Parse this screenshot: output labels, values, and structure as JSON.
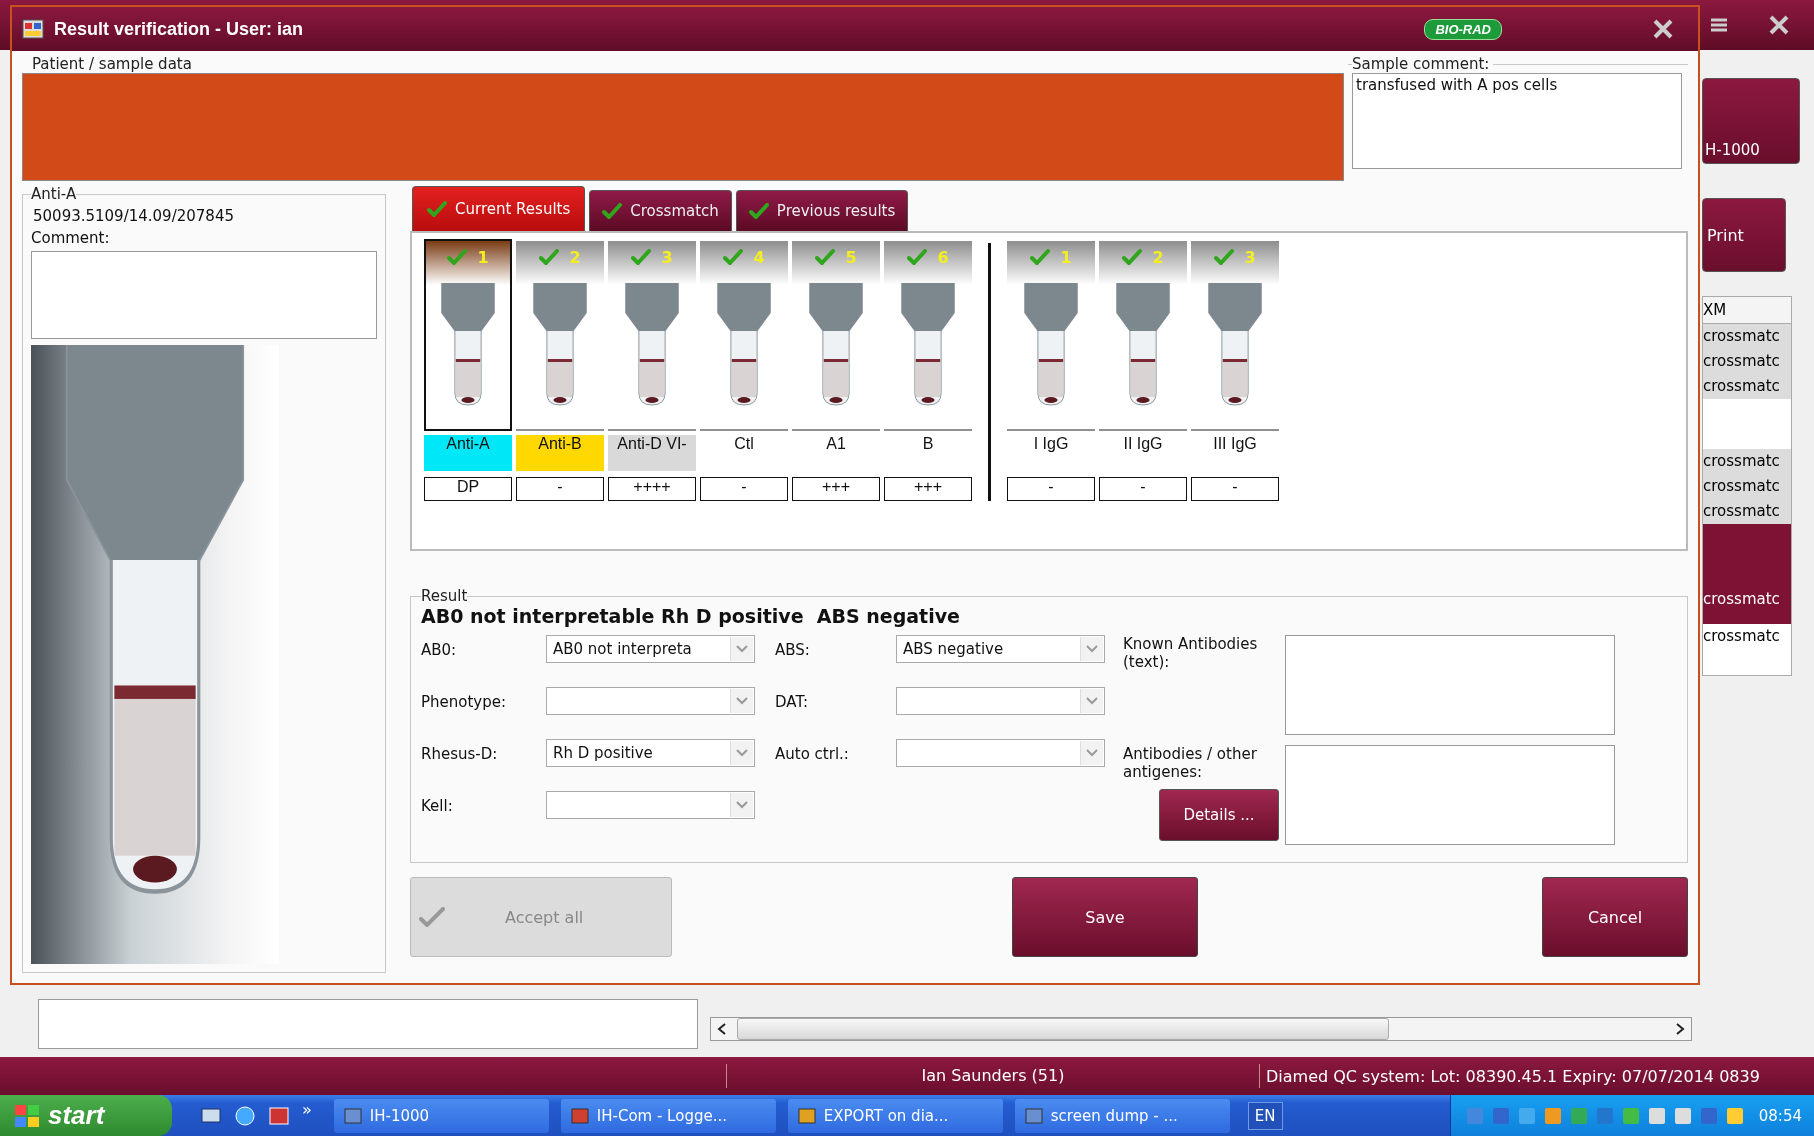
{
  "window": {
    "title": "Result verification - User: ian",
    "logo": "BIO-RAD"
  },
  "patient": {
    "legend": "Patient / sample data"
  },
  "sample_comment": {
    "label": "Sample comment:",
    "value": "transfused with A pos cells"
  },
  "selected_tube": {
    "legend": "Anti-A",
    "code": "50093.5109/14.09/207845",
    "comment_label": "Comment:"
  },
  "tabs": [
    {
      "label": "Current Results",
      "selected": true
    },
    {
      "label": "Crossmatch",
      "selected": false
    },
    {
      "label": "Previous results",
      "selected": false
    }
  ],
  "tube_groups": [
    {
      "tubes": [
        {
          "number": "1",
          "label": "Anti-A",
          "color": "#00e8f8",
          "result": "DP",
          "selected": true
        },
        {
          "number": "2",
          "label": "Anti-B",
          "color": "#ffd800",
          "result": "-",
          "selected": false
        },
        {
          "number": "3",
          "label": "Anti-D VI-",
          "color": "#d9d9d9",
          "result": "++++",
          "selected": false
        },
        {
          "number": "4",
          "label": "Ctl",
          "result": "-",
          "selected": false
        },
        {
          "number": "5",
          "label": "A1",
          "result": "+++",
          "selected": false
        },
        {
          "number": "6",
          "label": "B",
          "result": "+++",
          "selected": false
        }
      ]
    },
    {
      "tubes": [
        {
          "number": "1",
          "label": "I IgG",
          "result": "-",
          "selected": false
        },
        {
          "number": "2",
          "label": "II IgG",
          "result": "-",
          "selected": false
        },
        {
          "number": "3",
          "label": "III IgG",
          "result": "-",
          "selected": false
        }
      ]
    }
  ],
  "result": {
    "legend": "Result",
    "summary": "AB0 not interpretable Rh D positive  ABS negative",
    "fields": [
      {
        "label": "AB0:",
        "value": "AB0 not interpreta"
      },
      {
        "label": "ABS:",
        "value": "ABS negative"
      },
      {
        "label": "Phenotype:"
      },
      {
        "label": "DAT:"
      },
      {
        "label": "Rhesus-D:",
        "value": "Rh D positive"
      },
      {
        "label": "Auto ctrl.:"
      },
      {
        "label": "Kell:"
      }
    ],
    "known_antibodies_label": "Known Antibodies (text):",
    "antibodies_label": "Antibodies / other antigenes:",
    "details_button": "Details ..."
  },
  "buttons": [
    {
      "label": "Accept all",
      "disabled": true
    },
    {
      "label": "Save",
      "disabled": false
    },
    {
      "label": "Cancel",
      "disabled": false
    }
  ],
  "background_window": {
    "device_button": "H-1000",
    "print_button": "Print",
    "list_header": "XM",
    "list_rows": [
      {
        "text": "crossmatc",
        "selected": false,
        "shaded": true,
        "spaced": false
      },
      {
        "text": "crossmatc",
        "selected": false,
        "shaded": true,
        "spaced": false
      },
      {
        "text": "crossmatc",
        "selected": false,
        "shaded": true,
        "spaced": false
      },
      {
        "text": "crossmatc",
        "selected": false,
        "shaded": true,
        "spaced": true
      },
      {
        "text": "crossmatc",
        "selected": false,
        "shaded": true,
        "spaced": false
      },
      {
        "text": "crossmatc",
        "selected": false,
        "shaded": true,
        "spaced": false
      },
      {
        "text": "crossmatc",
        "selected": true,
        "shaded": false,
        "spaced": true
      },
      {
        "text": "crossmatc",
        "selected": false,
        "shaded": false,
        "spaced": false
      }
    ]
  },
  "status_bar": [
    "Ian Saunders (51)",
    "Diamed QC system: Lot: 08390.45.1 Expiry: 07/07/2014 0839"
  ],
  "taskbar": {
    "start": "start",
    "more": "»",
    "tasks": [
      "IH-1000",
      "IH-Com - Logge...",
      "EXPORT on dia...",
      "screen dump - ..."
    ],
    "language": "EN",
    "clock": "08:54"
  }
}
